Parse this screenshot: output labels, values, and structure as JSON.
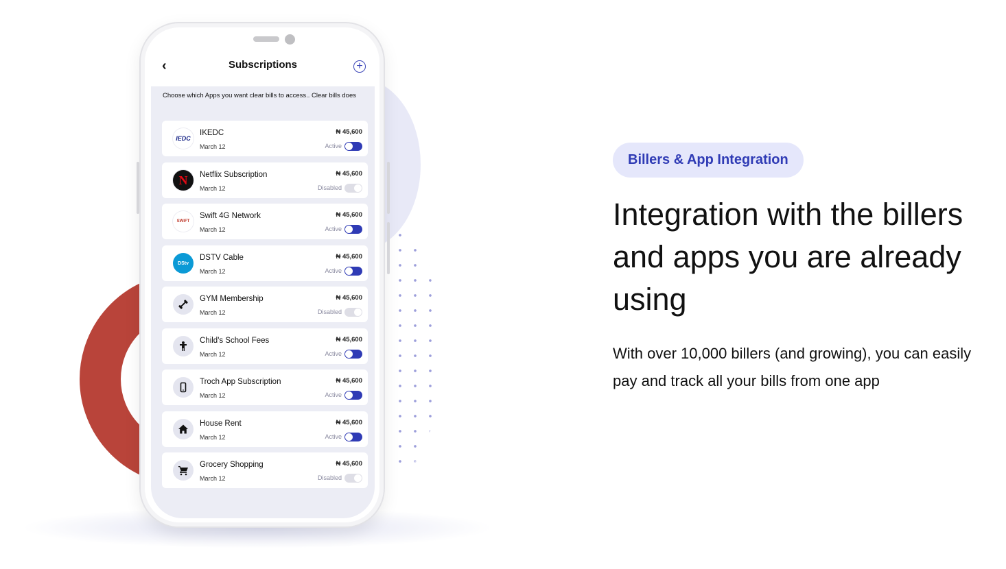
{
  "phone": {
    "screen_title": "Subscriptions",
    "intro": "Choose which Apps you want clear bills to access.. Clear bills does",
    "subscriptions": [
      {
        "name": "IKEDC",
        "date": "March 12",
        "amount": "₦ 45,600",
        "status": "Active",
        "enabled": true,
        "logo_text": "IEDC"
      },
      {
        "name": "Netflix Subscription",
        "date": "March 12",
        "amount": "₦ 45,600",
        "status": "Disabled",
        "enabled": false,
        "logo_text": "N"
      },
      {
        "name": "Swift 4G Network",
        "date": "March 12",
        "amount": "₦ 45,600",
        "status": "Active",
        "enabled": true,
        "logo_text": "SWIFT"
      },
      {
        "name": "DSTV Cable",
        "date": "March 12",
        "amount": "₦ 45,600",
        "status": "Active",
        "enabled": true,
        "logo_text": "DStv"
      },
      {
        "name": "GYM Membership",
        "date": "March 12",
        "amount": "₦ 45,600",
        "status": "Disabled",
        "enabled": false,
        "logo_text": ""
      },
      {
        "name": "Child's School Fees",
        "date": "March 12",
        "amount": "₦ 45,600",
        "status": "Active",
        "enabled": true,
        "logo_text": ""
      },
      {
        "name": "Troch App Subscription",
        "date": "March 12",
        "amount": "₦ 45,600",
        "status": "Active",
        "enabled": true,
        "logo_text": ""
      },
      {
        "name": "House Rent",
        "date": "March 12",
        "amount": "₦ 45,600",
        "status": "Active",
        "enabled": true,
        "logo_text": ""
      },
      {
        "name": "Grocery Shopping",
        "date": "March 12",
        "amount": "₦ 45,600",
        "status": "Disabled",
        "enabled": false,
        "logo_text": ""
      }
    ],
    "icons": [
      "ikedc-logo-icon",
      "netflix-logo-icon",
      "swift-logo-icon",
      "dstv-logo-icon",
      "dumbbell-icon",
      "child-icon",
      "phone-icon",
      "home-icon",
      "cart-icon"
    ]
  },
  "feature": {
    "badge": "Billers & App Integration",
    "headline": "Integration with the billers and apps you are already using",
    "description": "With over 10,000 billers (and growing), you can easily pay and track all your bills from one app"
  },
  "colors": {
    "accent": "#2f3bb5",
    "badge_bg": "#e5e7fb",
    "ring": "#b9443a",
    "netflix": "#e50914",
    "dstv": "#0b9ad6"
  }
}
